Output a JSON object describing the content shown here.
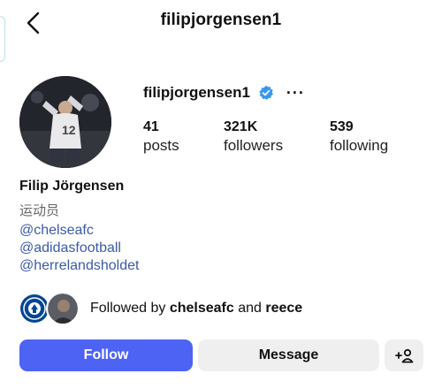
{
  "header": {
    "title": "filipjorgensen1",
    "back_icon": "chevron-left-icon"
  },
  "profile": {
    "username": "filipjorgensen1",
    "verified": true,
    "verified_color": "#3897f0",
    "more_label": "···",
    "stats": [
      {
        "value": "41",
        "label": "posts"
      },
      {
        "value": "321K",
        "label": "followers"
      },
      {
        "value": "539",
        "label": "following"
      }
    ],
    "full_name": "Filip Jörgensen",
    "category": "运动员",
    "links": [
      "@chelseafc",
      "@adidasfootball",
      "@herrelandsholdet"
    ],
    "link_color": "#3b5aa8"
  },
  "followed_by": {
    "prefix": "Followed by",
    "names": [
      "chelseafc",
      "reece"
    ],
    "joiner": "and"
  },
  "actions": {
    "follow_label": "Follow",
    "message_label": "Message",
    "suggest_icon": "add-person-icon",
    "follow_color": "#4d63f3"
  }
}
